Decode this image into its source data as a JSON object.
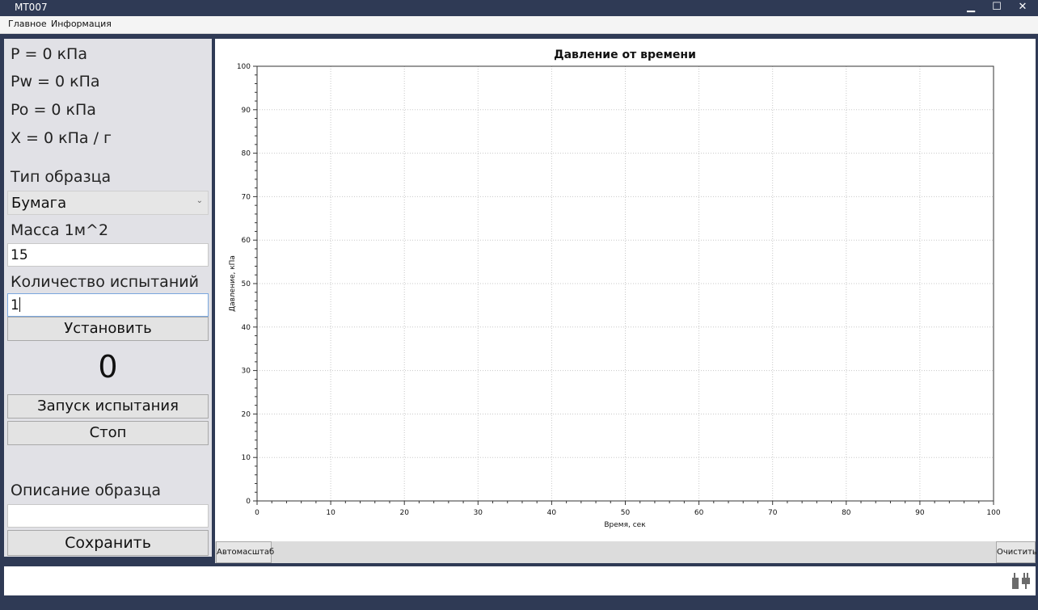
{
  "window": {
    "title": "MT007",
    "minimize": "▁",
    "maximize": "☐",
    "close": "✕"
  },
  "menu": {
    "items": [
      "Главное",
      "Информация"
    ]
  },
  "readings": {
    "p": "P = 0 кПа",
    "pw": "Pw = 0 кПа",
    "po": "Po = 0 кПа",
    "x": "X = 0 кПа / г"
  },
  "sample_type": {
    "label": "Тип образца",
    "value": "Бумага"
  },
  "mass": {
    "label": "Масса 1м^2",
    "value": "15"
  },
  "tests": {
    "label": "Количество испытаний",
    "value": "1"
  },
  "buttons": {
    "set": "Установить",
    "start": "Запуск испытания",
    "stop": "Стоп",
    "save": "Сохранить",
    "autoscale": "Автомасштаб",
    "clear": "Очистить"
  },
  "counter": "0",
  "description": {
    "label": "Описание образца",
    "value": ""
  },
  "icons": {
    "status": "plug-icon",
    "select": "chevron-down-icon"
  },
  "chart_data": {
    "type": "line",
    "title": "Давление от времени",
    "xlabel": "Время, сек",
    "ylabel": "Давление, кПа",
    "xlim": [
      0,
      100
    ],
    "ylim": [
      0,
      100
    ],
    "xticks": [
      0,
      10,
      20,
      30,
      40,
      50,
      60,
      70,
      80,
      90,
      100
    ],
    "yticks": [
      0,
      10,
      20,
      30,
      40,
      50,
      60,
      70,
      80,
      90,
      100
    ],
    "grid": true,
    "series": []
  }
}
